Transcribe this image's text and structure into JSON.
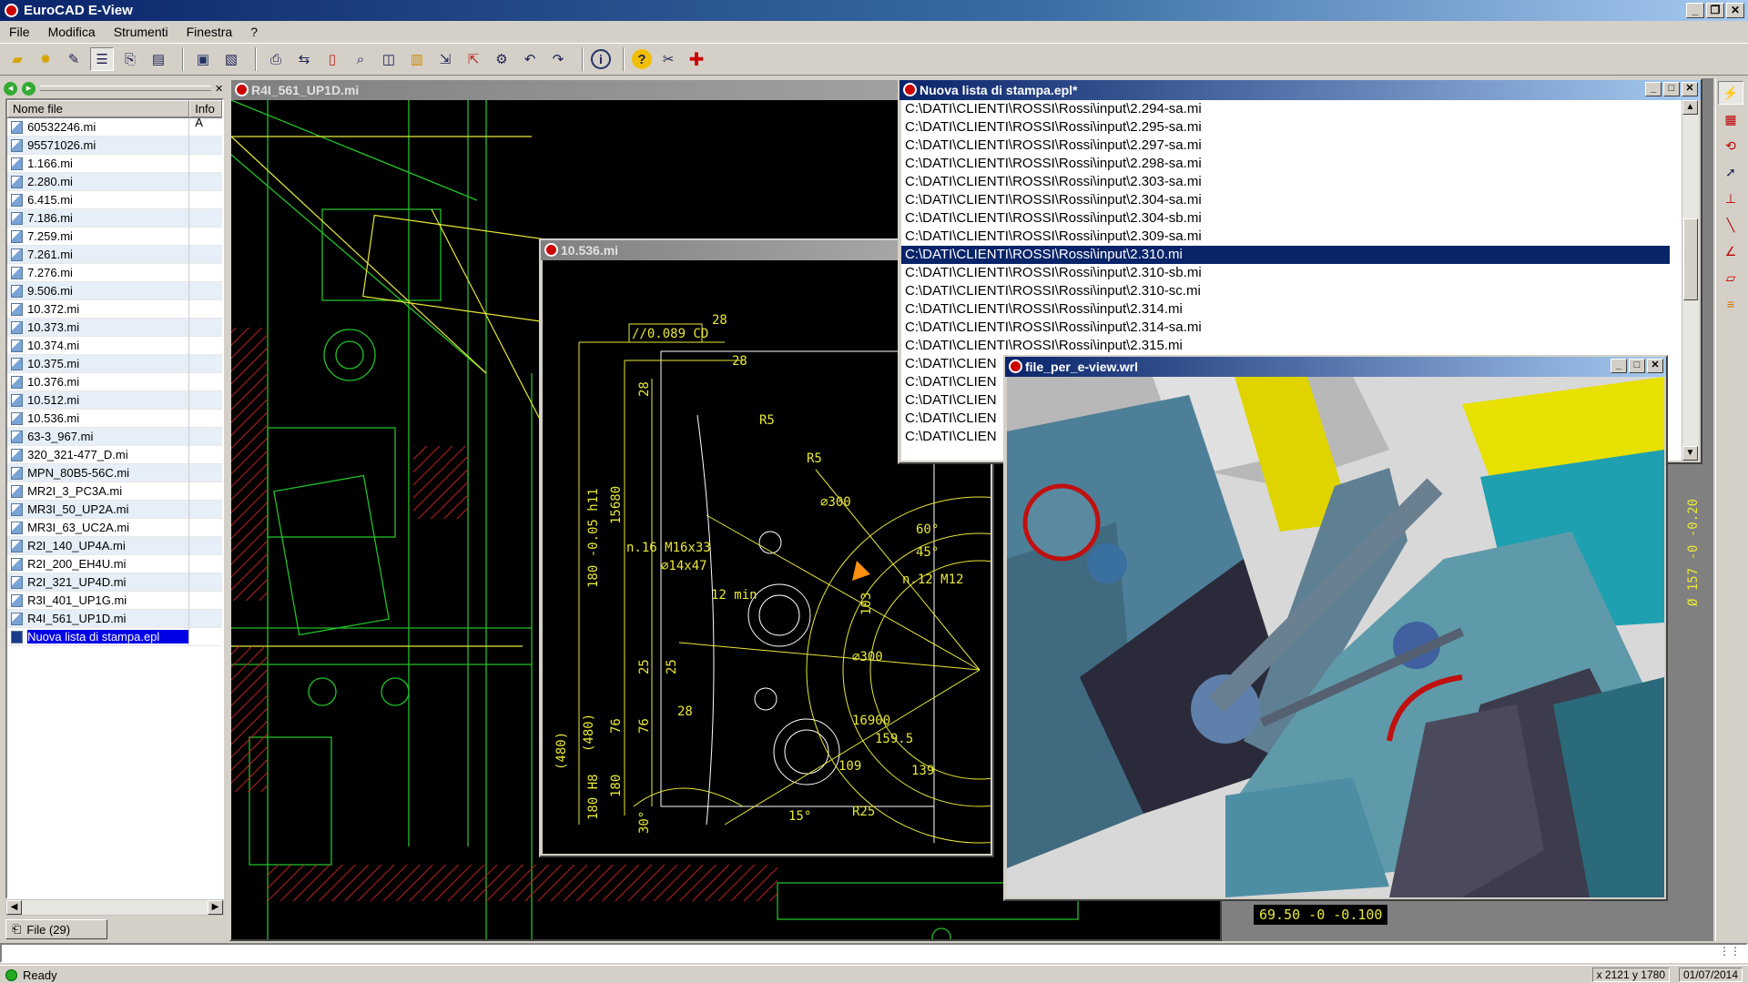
{
  "app": {
    "title": "EuroCAD E-View"
  },
  "menu": [
    "File",
    "Modifica",
    "Strumenti",
    "Finestra",
    "?"
  ],
  "toolbar_icons": [
    "open-folder-icon",
    "new-file-icon",
    "edit-icon",
    "list-view-icon",
    "copy-icon",
    "print-preview-icon",
    "save-icon",
    "save-as-icon",
    "print-icon",
    "print-setup-icon",
    "page-icon",
    "zoom-icon",
    "layers-icon",
    "bookmark-icon",
    "export-icon",
    "import-icon",
    "plot-icon",
    "undo-icon",
    "redo-icon",
    "info-icon",
    "help-icon",
    "tools-icon",
    "firstaid-icon"
  ],
  "left_panel": {
    "columns": [
      "Nome file",
      "Info A"
    ],
    "files": [
      "60532246.mi",
      "95571026.mi",
      "1.166.mi",
      "2.280.mi",
      "6.415.mi",
      "7.186.mi",
      "7.259.mi",
      "7.261.mi",
      "7.276.mi",
      "9.506.mi",
      "10.372.mi",
      "10.373.mi",
      "10.374.mi",
      "10.375.mi",
      "10.376.mi",
      "10.512.mi",
      "10.536.mi",
      "63-3_967.mi",
      "320_321-477_D.mi",
      "MPN_80B5-56C.mi",
      "MR2I_3_PC3A.mi",
      "MR3I_50_UP2A.mi",
      "MR3I_63_UC2A.mi",
      "R2I_140_UP4A.mi",
      "R2I_200_EH4U.mi",
      "R2I_321_UP4D.mi",
      "R3I_401_UP1G.mi",
      "R4I_561_UP1D.mi",
      "Nuova lista di stampa.epl"
    ],
    "selected_index": 28,
    "tab_label": "File (29)"
  },
  "windows": {
    "main_drawing": {
      "title": "R4I_561_UP1D.mi"
    },
    "detail_drawing": {
      "title": "10.536.mi",
      "labels": [
        "//0.089 CD",
        "28",
        "28",
        "28",
        "180 -0.05 h11",
        "15680",
        "n.16 M16x33",
        "⌀14x47",
        "12 min",
        "25",
        "25",
        "76",
        "76",
        "28",
        "(480)",
        "(480)",
        "180 H8",
        "180",
        "30°",
        "15°",
        "R5",
        "R5",
        "60°",
        "45°",
        "103",
        "⌀300",
        "n.12 M12",
        "⌀300",
        "109",
        "159.5",
        "139",
        "16900",
        "R25"
      ]
    },
    "print_list": {
      "title": "Nuova lista di stampa.epl*",
      "rows": [
        "C:\\DATI\\CLIENTI\\ROSSI\\Rossi\\input\\2.294-sa.mi",
        "C:\\DATI\\CLIENTI\\ROSSI\\Rossi\\input\\2.295-sa.mi",
        "C:\\DATI\\CLIENTI\\ROSSI\\Rossi\\input\\2.297-sa.mi",
        "C:\\DATI\\CLIENTI\\ROSSI\\Rossi\\input\\2.298-sa.mi",
        "C:\\DATI\\CLIENTI\\ROSSI\\Rossi\\input\\2.303-sa.mi",
        "C:\\DATI\\CLIENTI\\ROSSI\\Rossi\\input\\2.304-sa.mi",
        "C:\\DATI\\CLIENTI\\ROSSI\\Rossi\\input\\2.304-sb.mi",
        "C:\\DATI\\CLIENTI\\ROSSI\\Rossi\\input\\2.309-sa.mi",
        "C:\\DATI\\CLIENTI\\ROSSI\\Rossi\\input\\2.310.mi",
        "C:\\DATI\\CLIENTI\\ROSSI\\Rossi\\input\\2.310-sb.mi",
        "C:\\DATI\\CLIENTI\\ROSSI\\Rossi\\input\\2.310-sc.mi",
        "C:\\DATI\\CLIENTI\\ROSSI\\Rossi\\input\\2.314.mi",
        "C:\\DATI\\CLIENTI\\ROSSI\\Rossi\\input\\2.314-sa.mi",
        "C:\\DATI\\CLIENTI\\ROSSI\\Rossi\\input\\2.315.mi",
        "C:\\DATI\\CLIEN",
        "C:\\DATI\\CLIEN",
        "C:\\DATI\\CLIEN",
        "C:\\DATI\\CLIEN",
        "C:\\DATI\\CLIEN"
      ],
      "selected_index": 8
    },
    "viewer3d": {
      "title": "file_per_e-view.wrl"
    }
  },
  "dims": {
    "bottom": "69.50 -0 -0.100",
    "right": "Ø 157 -0 -0.20"
  },
  "right_tools": [
    "lightning-icon",
    "palette-icon",
    "refresh-icon",
    "pointer-icon",
    "measure-icon",
    "line-icon",
    "angle-icon",
    "layer-icon",
    "hatch-icon"
  ],
  "status": {
    "text": "Ready",
    "coords": "x 2121  y 1780",
    "date": "01/07/2014"
  },
  "colors": {
    "cad_bg": "#000000",
    "cad_green": "#22c02a",
    "cad_yellow": "#e8e838",
    "cad_red": "#c02020",
    "selection": "#0a246a",
    "file_selection": "#0000e6"
  }
}
